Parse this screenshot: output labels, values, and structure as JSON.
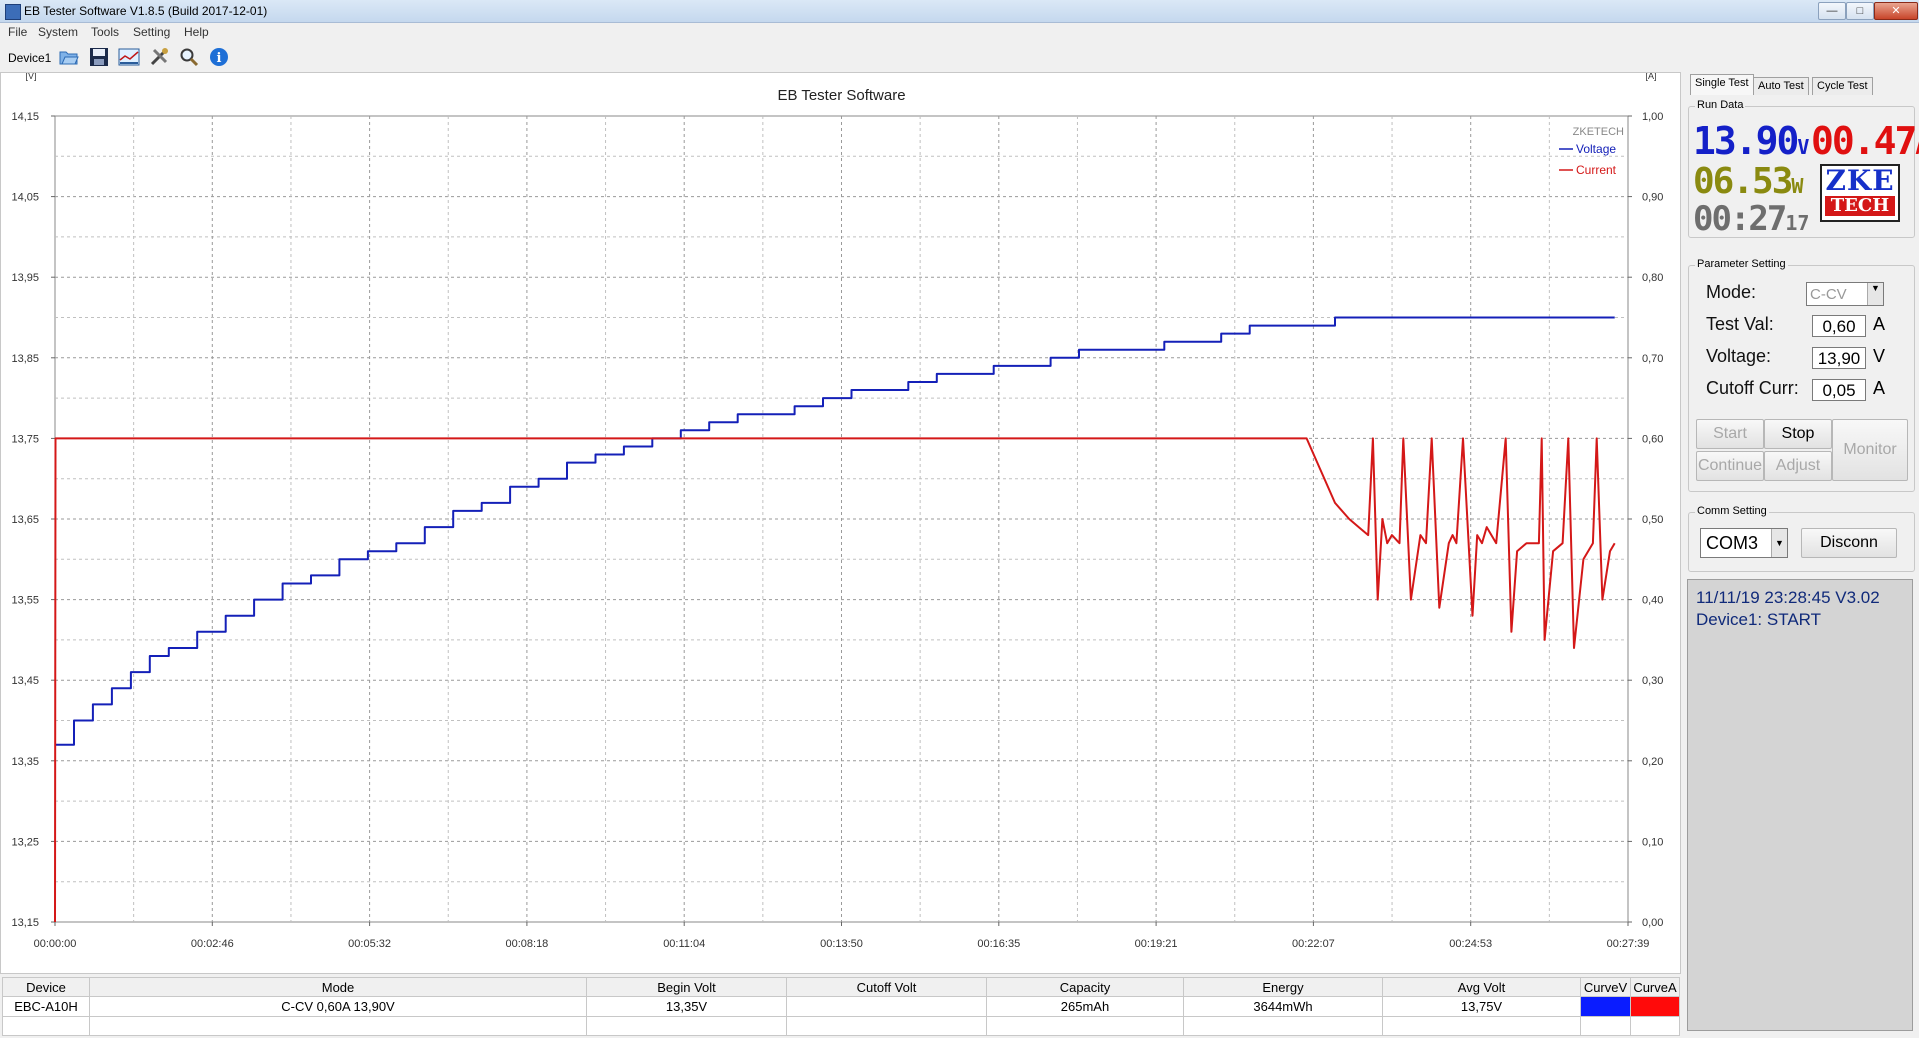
{
  "window": {
    "title": "EB Tester Software V1.8.5 (Build 2017-12-01)",
    "controls": [
      "—",
      "□",
      "✕"
    ]
  },
  "menu": [
    "File",
    "System",
    "Tools",
    "Setting",
    "Help"
  ],
  "toolbar": {
    "device_label": "Device1",
    "buttons": [
      "open-icon",
      "save-icon",
      "chart-icon",
      "tools-icon",
      "search-icon",
      "info-icon"
    ]
  },
  "chart_data": {
    "type": "line",
    "title": "EB Tester Software",
    "watermark": "ZKETECH",
    "y_left_unit": "[V]",
    "y_right_unit": "[A]",
    "y_left_range": [
      13.15,
      14.15
    ],
    "y_right_range": [
      0.0,
      1.0
    ],
    "x_range_seconds": [
      0,
      1659
    ],
    "legend_position": "top-right",
    "grid": true,
    "y_left_ticks": [
      "14,15",
      "14,05",
      "13,95",
      "13,85",
      "13,75",
      "13,65",
      "13,55",
      "13,45",
      "13,35",
      "13,25",
      "13,15"
    ],
    "y_right_ticks": [
      "1,00",
      "0,90",
      "0,80",
      "0,70",
      "0,60",
      "0,50",
      "0,40",
      "0,30",
      "0,20",
      "0,10",
      "0,00"
    ],
    "x_ticks": [
      "00:00:00",
      "00:02:46",
      "00:05:32",
      "00:08:18",
      "00:11:04",
      "00:13:50",
      "00:16:35",
      "00:19:21",
      "00:22:07",
      "00:24:53",
      "00:27:39"
    ],
    "series": [
      {
        "name": "Voltage",
        "color": "#1420b8",
        "axis": "left",
        "x_seconds": [
          0,
          20,
          40,
          60,
          80,
          100,
          120,
          150,
          180,
          210,
          240,
          270,
          300,
          330,
          360,
          390,
          420,
          450,
          480,
          510,
          540,
          570,
          600,
          630,
          660,
          690,
          720,
          750,
          780,
          810,
          840,
          870,
          900,
          930,
          960,
          990,
          1020,
          1050,
          1080,
          1110,
          1140,
          1170,
          1200,
          1230,
          1260,
          1290,
          1320,
          1350,
          1380,
          1410,
          1645
        ],
        "values": [
          13.37,
          13.4,
          13.42,
          13.44,
          13.46,
          13.48,
          13.49,
          13.51,
          13.53,
          13.55,
          13.57,
          13.58,
          13.6,
          13.61,
          13.62,
          13.64,
          13.66,
          13.67,
          13.69,
          13.7,
          13.72,
          13.73,
          13.74,
          13.75,
          13.76,
          13.77,
          13.78,
          13.78,
          13.79,
          13.8,
          13.81,
          13.81,
          13.82,
          13.83,
          13.83,
          13.84,
          13.84,
          13.85,
          13.86,
          13.86,
          13.86,
          13.87,
          13.87,
          13.88,
          13.89,
          13.89,
          13.89,
          13.9,
          13.9,
          13.9,
          13.9
        ]
      },
      {
        "name": "Current",
        "color": "#d41818",
        "axis": "right",
        "x_seconds": [
          0,
          0.5,
          1320,
          1335,
          1350,
          1365,
          1375,
          1385,
          1390,
          1395,
          1400,
          1405,
          1410,
          1418,
          1422,
          1430,
          1440,
          1446,
          1452,
          1460,
          1470,
          1474,
          1478,
          1485,
          1495,
          1500,
          1505,
          1510,
          1520,
          1530,
          1536,
          1542,
          1552,
          1565,
          1568,
          1571,
          1580,
          1590,
          1596,
          1602,
          1612,
          1622,
          1626,
          1632,
          1640,
          1645
        ],
        "values": [
          0.0,
          0.6,
          0.6,
          0.56,
          0.52,
          0.5,
          0.49,
          0.48,
          0.6,
          0.4,
          0.5,
          0.47,
          0.48,
          0.47,
          0.6,
          0.4,
          0.48,
          0.47,
          0.6,
          0.39,
          0.47,
          0.48,
          0.47,
          0.6,
          0.38,
          0.48,
          0.47,
          0.49,
          0.47,
          0.6,
          0.36,
          0.46,
          0.47,
          0.47,
          0.6,
          0.35,
          0.46,
          0.47,
          0.6,
          0.34,
          0.45,
          0.47,
          0.6,
          0.4,
          0.46,
          0.47
        ]
      }
    ]
  },
  "tabs": [
    "Single Test",
    "Auto Test",
    "Cycle Test"
  ],
  "run_data": {
    "title": "Run Data",
    "voltage": "13.90",
    "voltage_unit": "V",
    "current": "00.47",
    "current_unit": "A",
    "power": "06.53",
    "power_unit": "W",
    "time": "00:27",
    "time_seconds": "17",
    "logo_line1": "ZKE",
    "logo_line2": "TECH"
  },
  "params": {
    "title": "Parameter Setting",
    "mode_label": "Mode:",
    "mode_value": "C-CV",
    "test_val_label": "Test Val:",
    "test_val": "0,60",
    "test_val_unit": "A",
    "voltage_label": "Voltage:",
    "voltage": "13,90",
    "voltage_unit": "V",
    "cutoff_label": "Cutoff Curr:",
    "cutoff": "0,05",
    "cutoff_unit": "A"
  },
  "controls": {
    "start": "Start",
    "stop": "Stop",
    "monitor": "Monitor",
    "continue": "Continue",
    "adjust": "Adjust"
  },
  "comm": {
    "title": "Comm Setting",
    "port": "COM3",
    "disconnect": "Disconn"
  },
  "status": {
    "line1": "11/11/19 23:28:45  V3.02",
    "line2": "Device1: START"
  },
  "table": {
    "headers": [
      "Device",
      "Mode",
      "Begin Volt",
      "Cutoff Volt",
      "Capacity",
      "Energy",
      "Avg Volt",
      "CurveV",
      "CurveA"
    ],
    "row": [
      "EBC-A10H",
      "C-CV  0,60A  13,90V",
      "13,35V",
      "",
      "265mAh",
      "3644mWh",
      "13,75V"
    ],
    "curve_colors": [
      "#0a1cff",
      "#ff0a0a"
    ]
  }
}
